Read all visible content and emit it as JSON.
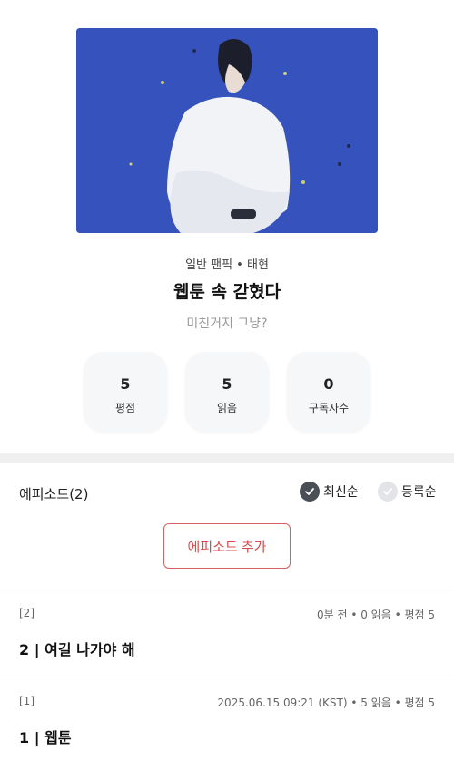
{
  "work": {
    "meta": "일반 팬픽 • 태현",
    "title": "웹툰 속 갇혔다",
    "subtitle": "미친거지 그냥?"
  },
  "stats": [
    {
      "value": "5",
      "label": "평점"
    },
    {
      "value": "5",
      "label": "읽음"
    },
    {
      "value": "0",
      "label": "구독자수"
    }
  ],
  "episodes_section": {
    "header": "에피소드(2)",
    "sort_latest": "최신순",
    "sort_registered": "등록순",
    "add_button": "에피소드 추가"
  },
  "episodes": [
    {
      "num": "[2]",
      "info": "0분 전 • 0 읽음 • 평점 5",
      "title": "2 | 여길 나가야 해"
    },
    {
      "num": "[1]",
      "info": "2025.06.15 09:21 (KST) • 5 읽음 • 평점 5",
      "title": "1 | 웹툰"
    }
  ],
  "colors": {
    "accent": "#d34f4f",
    "cover_bg": "#3455be",
    "sort_active": "#4a4f55",
    "sort_inactive": "#e2e4e7"
  },
  "icons": {
    "sort_latest": "check-icon",
    "sort_registered": "check-icon"
  }
}
